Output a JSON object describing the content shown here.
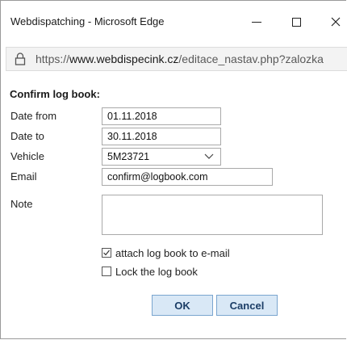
{
  "window": {
    "title": "Webdispatching - Microsoft Edge",
    "minimize_icon": "minimize-icon",
    "maximize_icon": "maximize-icon",
    "close_icon": "close-icon"
  },
  "address_bar": {
    "scheme": "https://",
    "host": "www.webdispecink.cz",
    "path": "/editace_nastav.php?zalozka",
    "icon": "lock-icon"
  },
  "form": {
    "heading": "Confirm log book:",
    "date_from": {
      "label": "Date from",
      "value": "01.11.2018"
    },
    "date_to": {
      "label": "Date to",
      "value": "30.11.2018"
    },
    "vehicle": {
      "label": "Vehicle",
      "value": "5M23721"
    },
    "email": {
      "label": "Email",
      "value": "confirm@logbook.com"
    },
    "note": {
      "label": "Note",
      "value": ""
    },
    "attach": {
      "label": "attach log book to e-mail",
      "checked": true
    },
    "lock": {
      "label": "Lock the log book",
      "checked": false
    },
    "ok_label": "OK",
    "cancel_label": "Cancel"
  },
  "colors": {
    "button_bg": "#d9e8f6",
    "button_border": "#7aa5cf",
    "button_text": "#1b3d66"
  }
}
